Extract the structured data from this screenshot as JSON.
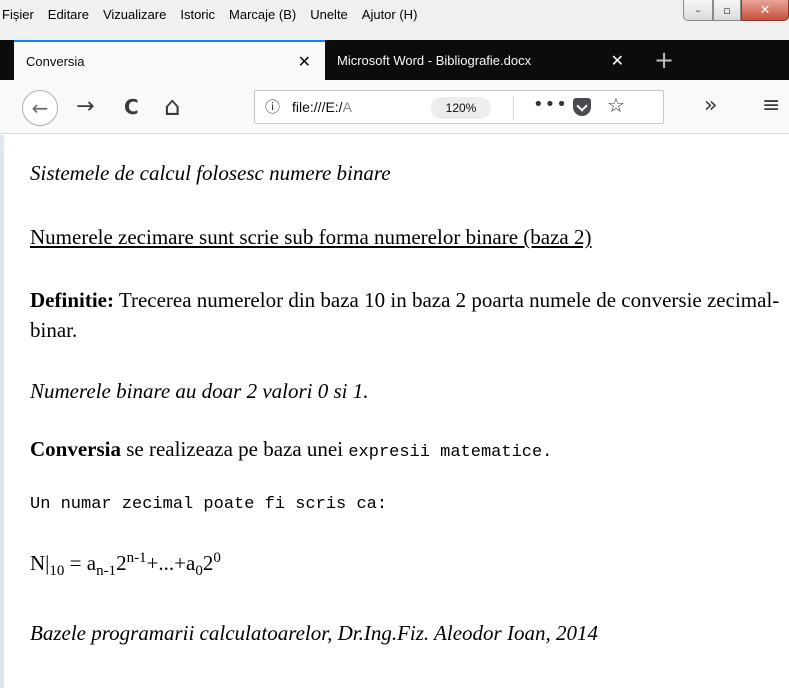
{
  "menu": {
    "items": [
      "Fișier",
      "Editare",
      "Vizualizare",
      "Istoric",
      "Marcaje (B)",
      "Unelte",
      "Ajutor (H)"
    ]
  },
  "window_controls": {
    "minimize": "–",
    "maximize": "▫",
    "close": "✕"
  },
  "tabs": [
    {
      "label": "Conversia",
      "close": "✕"
    },
    {
      "label": "Microsoft Word - Bibliografie.docx",
      "close": "✕"
    }
  ],
  "new_tab_icon": "+",
  "toolbar": {
    "back_icon": "←",
    "forward_icon": "→",
    "reload_icon": "C",
    "home_icon": "⌂",
    "info_icon": "ⓘ",
    "url_prefix": "file:///E:/",
    "url_dim": "A",
    "zoom": "120%",
    "more_icon": "•••",
    "star_icon": "☆",
    "overflow_icon": "»",
    "menu_icon": "≡"
  },
  "page": {
    "line1": "Sistemele de calcul folosesc numere binare",
    "line2": "Numerele zecimare sunt scrie sub forma numerelor binare (baza 2)",
    "def_bold": "Definitie:",
    "def_text": " Trecerea numerelor din baza 10 in baza 2 poarta numele de conversie zecimal-binar.",
    "line4": "Numerele binare au doar 2 valori 0 si 1.",
    "conv_bold": "Conversia",
    "conv_text": " se realizeaza pe baza unei ",
    "conv_mono": "expresii matematice.",
    "line6": "Un numar zecimal poate fi scris ca:",
    "formula": {
      "n": "N",
      "bar": "|",
      "sub10": "10",
      "eq": " = a",
      "sub_n1": "n-1",
      "two1": "2",
      "sup_n1": "n-1",
      "dots": "+...+a",
      "sub0": "0",
      "two2": "2",
      "sup0": "0"
    },
    "line8": "Bazele programarii calculatoarelor, Dr.Ing.Fiz. Aleodor Ioan, 2014"
  }
}
